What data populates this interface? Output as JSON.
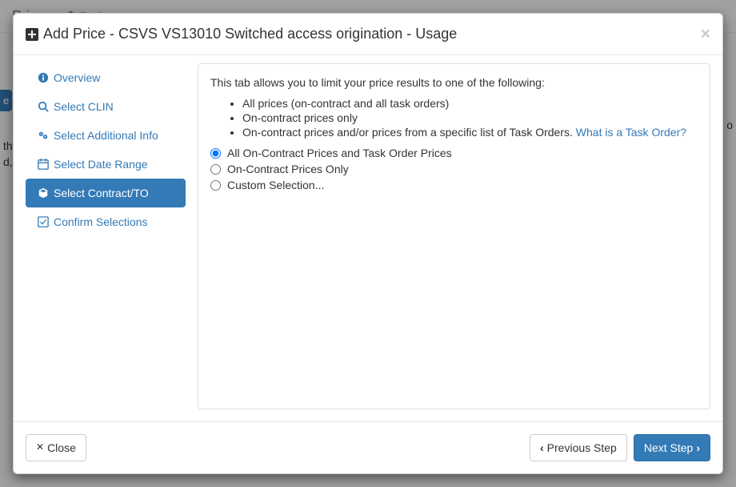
{
  "navbar": {
    "brand": "Pricer",
    "tools": "Tools"
  },
  "background": {
    "pill": "e",
    "line1": "th",
    "line2": "d,",
    "right_frag": "o"
  },
  "modal": {
    "title": "Add Price - CSVS VS13010 Switched access origination - Usage"
  },
  "sidebar": {
    "items": [
      {
        "label": "Overview"
      },
      {
        "label": "Select CLIN"
      },
      {
        "label": "Select Additional Info"
      },
      {
        "label": "Select Date Range"
      },
      {
        "label": "Select Contract/TO"
      },
      {
        "label": "Confirm Selections"
      }
    ],
    "active_index": 4
  },
  "panel": {
    "intro": "This tab allows you to limit your price results to one of the following:",
    "bullets": [
      "All prices (on-contract and all task orders)",
      "On-contract prices only",
      "On-contract prices and/or prices from a specific list of Task Orders."
    ],
    "help_link": "What is a Task Order?",
    "radios": [
      "All On-Contract Prices and Task Order Prices",
      "On-Contract Prices Only",
      "Custom Selection..."
    ],
    "selected_radio": 0
  },
  "footer": {
    "close": "Close",
    "prev": "Previous Step",
    "next": "Next Step"
  }
}
